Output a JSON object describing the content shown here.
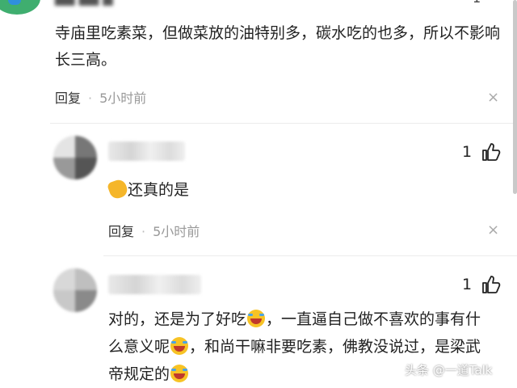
{
  "top_comment": {
    "count": "1",
    "body": "寺庙里吃素菜，但做菜放的油特别多，碳水吃的也多，所以不影响长三高。",
    "reply_label": "回复",
    "time": "5小时前"
  },
  "replies": [
    {
      "likes": "1",
      "body": "还真的是",
      "reply_label": "回复",
      "time": "5小时前"
    },
    {
      "likes": "1",
      "body_parts": [
        "对的，还是为了好吃",
        "，一直逼自己做不喜欢的事有什么意义呢",
        "，和尚干嘛非要吃素，佛教没说过，是梁武帝规定的"
      ]
    }
  ],
  "separator_dot": "·",
  "close_symbol": "×",
  "watermark": "头条 @一道Talk",
  "icons": {
    "like": "thumbs-up-icon",
    "close": "close-icon",
    "laugh_emoji": "laughing-tears-emoji-icon",
    "clap_emoji": "clapping-hands-emoji-icon"
  },
  "colors": {
    "meta_text": "#999999",
    "body_text": "#222222",
    "avatar_green": "#3fae6f",
    "emoji_yellow": "#f7c325"
  }
}
